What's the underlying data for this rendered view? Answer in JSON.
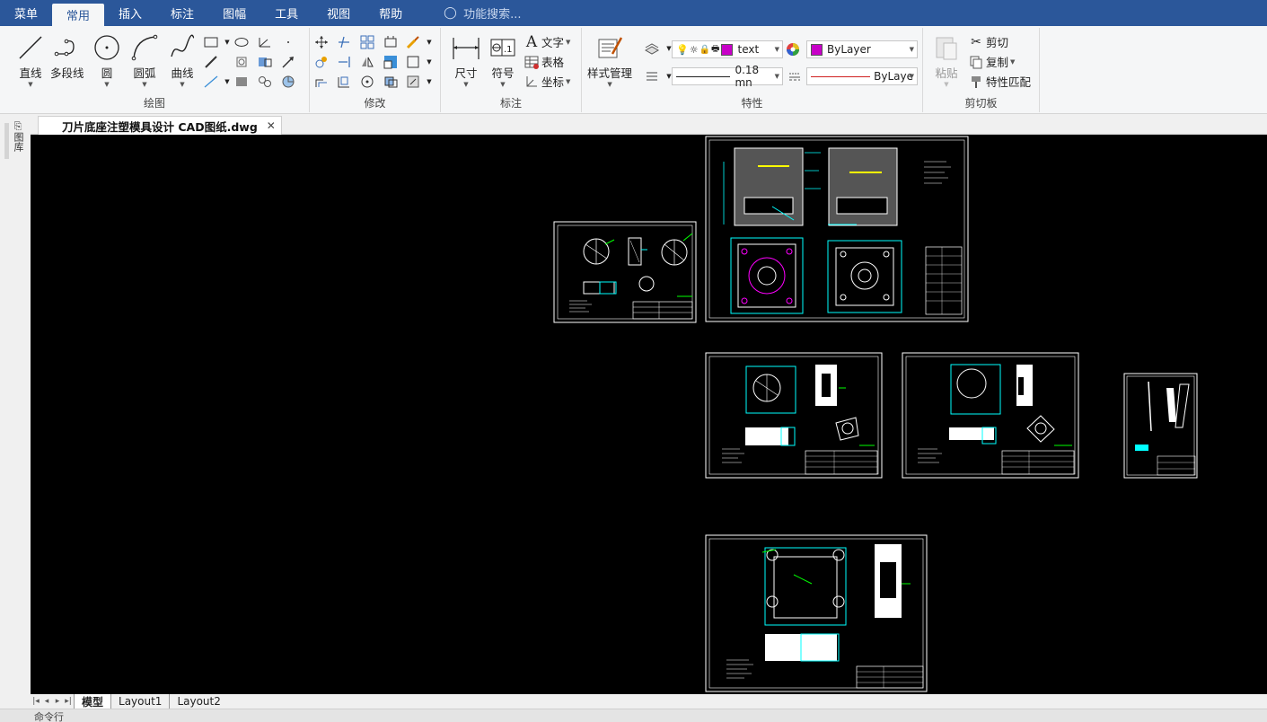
{
  "menubar": {
    "items": [
      {
        "label": "菜单",
        "active": false
      },
      {
        "label": "常用",
        "active": true
      },
      {
        "label": "插入",
        "active": false
      },
      {
        "label": "标注",
        "active": false
      },
      {
        "label": "图幅",
        "active": false
      },
      {
        "label": "工具",
        "active": false
      },
      {
        "label": "视图",
        "active": false
      },
      {
        "label": "帮助",
        "active": false
      }
    ],
    "search_placeholder": "功能搜索..."
  },
  "ribbon": {
    "draw": {
      "label": "绘图",
      "line": "直线",
      "polyline": "多段线",
      "circle": "圆",
      "arc": "圆弧",
      "curve": "曲线"
    },
    "modify": {
      "label": "修改"
    },
    "annotate": {
      "label": "标注",
      "dimension": "尺寸",
      "symbol": "符号",
      "text": "文字",
      "table": "表格",
      "coordinate": "坐标"
    },
    "properties": {
      "label": "特性",
      "style_manager": "样式管理",
      "text_style": "text",
      "lineweight": "0.18 mn",
      "color": "ByLayer",
      "linetype": "ByLaye",
      "layer_color": "#c800c8"
    },
    "clipboard": {
      "label": "剪切板",
      "paste": "粘贴",
      "cut": "剪切",
      "copy": "复制",
      "match_properties": "特性匹配"
    }
  },
  "leftstrip": {
    "label": "图库"
  },
  "document": {
    "tab_title": "刀片底座注塑模具设计 CAD图纸.dwg"
  },
  "layouts": {
    "tabs": [
      {
        "label": "模型",
        "active": true
      },
      {
        "label": "Layout1",
        "active": false
      },
      {
        "label": "Layout2",
        "active": false
      }
    ]
  },
  "command": {
    "prompt": "命令行"
  },
  "colors": {
    "accent": "#2b579a",
    "canvas": "#000000",
    "frame": "#ffffff",
    "cad_cyan": "#00ffff",
    "cad_green": "#00ff00",
    "cad_magenta": "#ff00ff",
    "cad_yellow": "#ffff00"
  }
}
